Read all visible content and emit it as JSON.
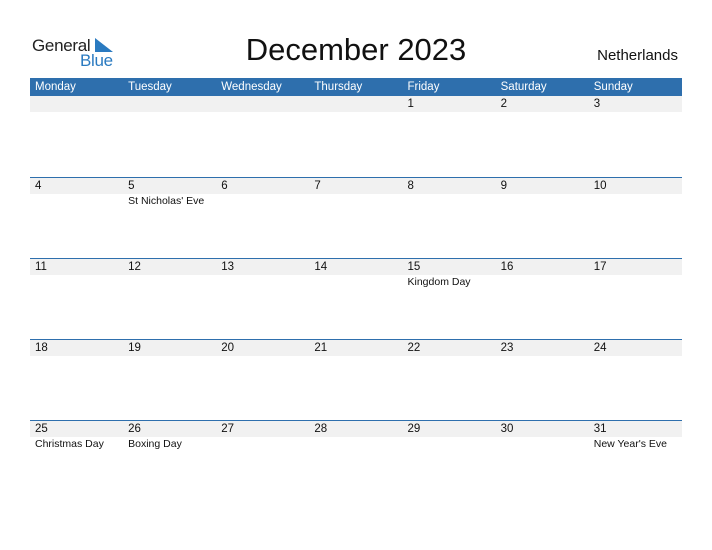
{
  "logo": {
    "general": "General",
    "blue": "Blue",
    "accent": "#2a7ac0"
  },
  "title": "December 2023",
  "country": "Netherlands",
  "header_color": "#2e6fad",
  "weekdays": [
    "Monday",
    "Tuesday",
    "Wednesday",
    "Thursday",
    "Friday",
    "Saturday",
    "Sunday"
  ],
  "weeks": [
    {
      "days": [
        "",
        "",
        "",
        "",
        "1",
        "2",
        "3"
      ],
      "events": [
        "",
        "",
        "",
        "",
        "",
        "",
        ""
      ]
    },
    {
      "days": [
        "4",
        "5",
        "6",
        "7",
        "8",
        "9",
        "10"
      ],
      "events": [
        "",
        "St Nicholas' Eve",
        "",
        "",
        "",
        "",
        ""
      ]
    },
    {
      "days": [
        "11",
        "12",
        "13",
        "14",
        "15",
        "16",
        "17"
      ],
      "events": [
        "",
        "",
        "",
        "",
        "Kingdom Day",
        "",
        ""
      ]
    },
    {
      "days": [
        "18",
        "19",
        "20",
        "21",
        "22",
        "23",
        "24"
      ],
      "events": [
        "",
        "",
        "",
        "",
        "",
        "",
        ""
      ]
    },
    {
      "days": [
        "25",
        "26",
        "27",
        "28",
        "29",
        "30",
        "31"
      ],
      "events": [
        "Christmas Day",
        "Boxing Day",
        "",
        "",
        "",
        "",
        "New Year's Eve"
      ]
    }
  ]
}
